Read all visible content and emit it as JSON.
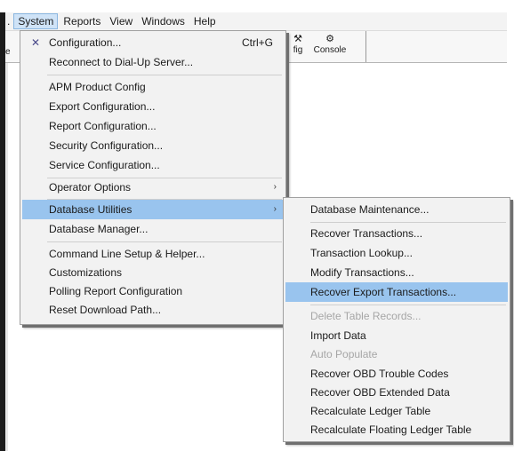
{
  "menubar": {
    "items": [
      "System",
      "Reports",
      "View",
      "Windows",
      "Help"
    ]
  },
  "toolbar": {
    "frag_left": "e",
    "config_frag": "fig",
    "console_label": "Console"
  },
  "system_menu": {
    "items": [
      {
        "label": "Configuration...",
        "shortcut": "Ctrl+G"
      },
      {
        "label": "Reconnect to Dial-Up Server..."
      },
      {
        "label": "APM Product Config"
      },
      {
        "label": "Export Configuration..."
      },
      {
        "label": "Report Configuration..."
      },
      {
        "label": "Security Configuration..."
      },
      {
        "label": "Service Configuration..."
      },
      {
        "label": "Operator Options"
      },
      {
        "label": "Database Utilities"
      },
      {
        "label": "Database Manager..."
      },
      {
        "label": "Command Line Setup & Helper..."
      },
      {
        "label": "Customizations"
      },
      {
        "label": "Polling Report Configuration"
      },
      {
        "label": "Reset Download Path..."
      }
    ]
  },
  "db_utilities_menu": {
    "items": [
      {
        "label": "Database Maintenance..."
      },
      {
        "label": "Recover Transactions..."
      },
      {
        "label": "Transaction Lookup..."
      },
      {
        "label": "Modify Transactions..."
      },
      {
        "label": "Recover Export Transactions..."
      },
      {
        "label": "Delete Table Records..."
      },
      {
        "label": "Import Data"
      },
      {
        "label": "Auto Populate"
      },
      {
        "label": "Recover OBD Trouble Codes"
      },
      {
        "label": "Recover OBD Extended Data"
      },
      {
        "label": "Recalculate Ledger Table"
      },
      {
        "label": "Recalculate Floating Ledger Table"
      }
    ]
  }
}
